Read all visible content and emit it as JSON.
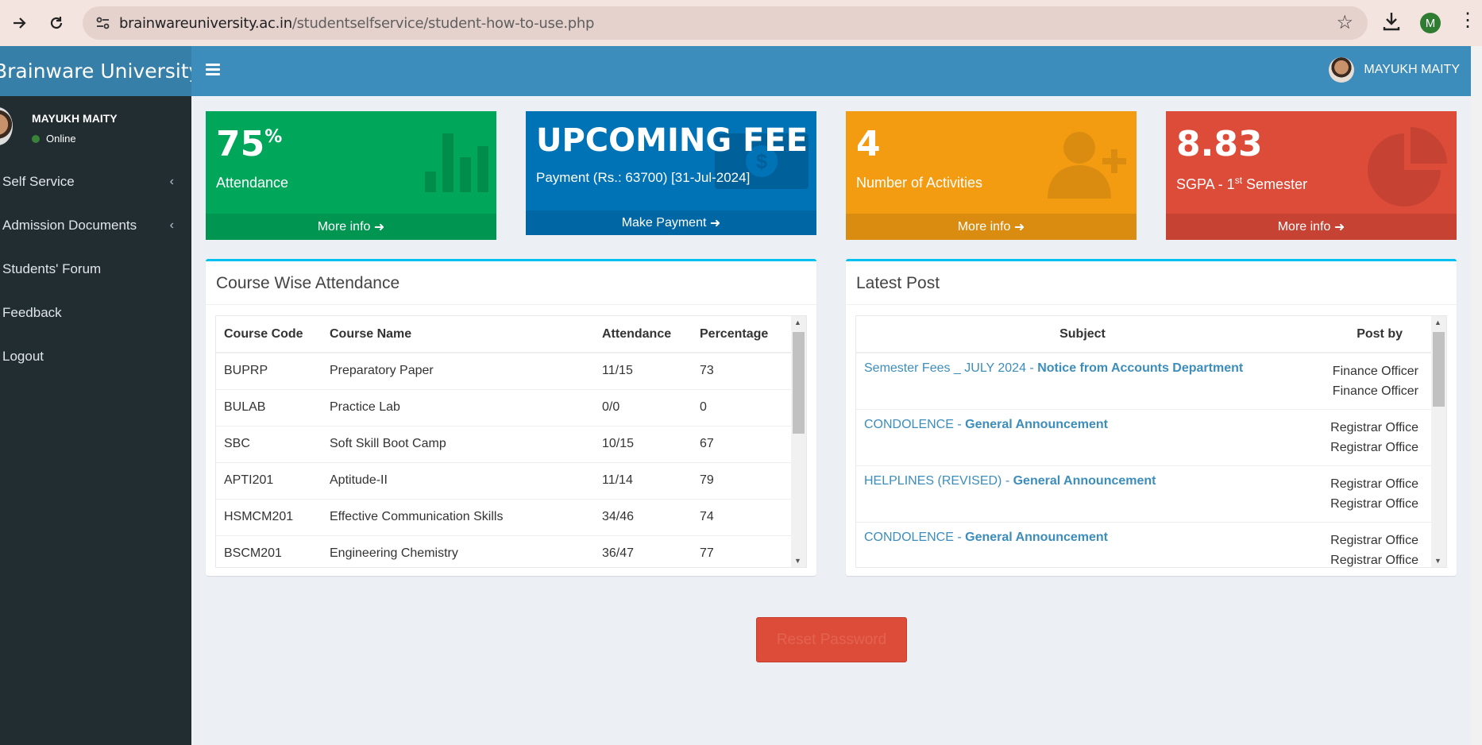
{
  "browser": {
    "url_domain": "brainwareuniversity.ac.in",
    "url_path": "/studentselfservice/student-how-to-use.php",
    "profile_initial": "M"
  },
  "app": {
    "logo_text": "Brainware University",
    "user_name": "MAYUKH MAITY",
    "status": "Online"
  },
  "sidebar": {
    "items": [
      {
        "label": "Self Service",
        "has_chevron": true
      },
      {
        "label": "Admission Documents",
        "has_chevron": true
      },
      {
        "label": "Students' Forum",
        "has_chevron": false
      },
      {
        "label": "Feedback",
        "has_chevron": false
      },
      {
        "label": "Logout",
        "has_chevron": false
      }
    ]
  },
  "boxes": {
    "attendance": {
      "value": "75",
      "unit": "%",
      "label": "Attendance",
      "link": "More info",
      "color": "#00a65a"
    },
    "fee": {
      "value": "UPCOMING FEE",
      "label": "Payment (Rs.: 63700) [31-Jul-2024]",
      "link": "Make Payment",
      "color": "#0073b7"
    },
    "activities": {
      "value": "4",
      "label": "Number of Activities",
      "link": "More info",
      "color": "#f39c12"
    },
    "sgpa": {
      "value": "8.83",
      "label_pre": "SGPA - 1",
      "label_sup": "st",
      "label_post": " Semester",
      "link": "More info",
      "color": "#dd4b39"
    }
  },
  "course_attendance": {
    "title": "Course Wise Attendance",
    "headers": [
      "Course Code",
      "Course Name",
      "Attendance",
      "Percentage"
    ],
    "rows": [
      [
        "BUPRP",
        "Preparatory Paper",
        "11/15",
        "73"
      ],
      [
        "BULAB",
        "Practice Lab",
        "0/0",
        "0"
      ],
      [
        "SBC",
        "Soft Skill Boot Camp",
        "10/15",
        "67"
      ],
      [
        "APTI201",
        "Aptitude-II",
        "11/14",
        "79"
      ],
      [
        "HSMCM201",
        "Effective Communication Skills",
        "34/46",
        "74"
      ],
      [
        "BSCM201",
        "Engineering Chemistry",
        "36/47",
        "77"
      ]
    ]
  },
  "latest_post": {
    "title": "Latest Post",
    "headers": [
      "Subject",
      "Post by"
    ],
    "rows": [
      {
        "subject": "Semester Fees _ JULY 2024 - ",
        "category": "Notice from Accounts Department",
        "by1": "Finance Officer",
        "by2": "Finance Officer"
      },
      {
        "subject": "CONDOLENCE - ",
        "category": "General Announcement",
        "by1": "Registrar Office",
        "by2": "Registrar Office"
      },
      {
        "subject": "HELPLINES (REVISED) - ",
        "category": "General Announcement",
        "by1": "Registrar Office",
        "by2": "Registrar Office"
      },
      {
        "subject": "CONDOLENCE - ",
        "category": "General Announcement",
        "by1": "Registrar Office",
        "by2": "Registrar Office"
      }
    ]
  },
  "reset_button": "Reset Password"
}
